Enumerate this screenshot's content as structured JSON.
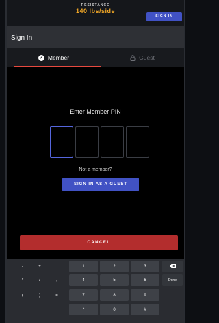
{
  "top_bar": {
    "resistance_label": "RESISTANCE",
    "resistance_value": "140",
    "resistance_unit": "lbs/side",
    "sign_in_label": "SIGN IN"
  },
  "header": {
    "title": "Sign In"
  },
  "tabs": [
    {
      "label": "Member"
    },
    {
      "label": "Guest"
    }
  ],
  "pin": {
    "prompt": "Enter Member PIN"
  },
  "guest": {
    "not_member_text": "Not a member?",
    "button_label": "SIGN IN AS A GUEST"
  },
  "cancel_label": "CANCEL",
  "keyboard": {
    "symbols": [
      "-",
      "+",
      ".",
      "*",
      "/",
      ",",
      "(",
      ")",
      "="
    ],
    "digits": [
      "1",
      "2",
      "3",
      "4",
      "5",
      "6",
      "7",
      "8",
      "9",
      "*",
      "0",
      "#"
    ],
    "done_label": "Done",
    "icons": {
      "backspace": "backspace-icon"
    }
  }
}
